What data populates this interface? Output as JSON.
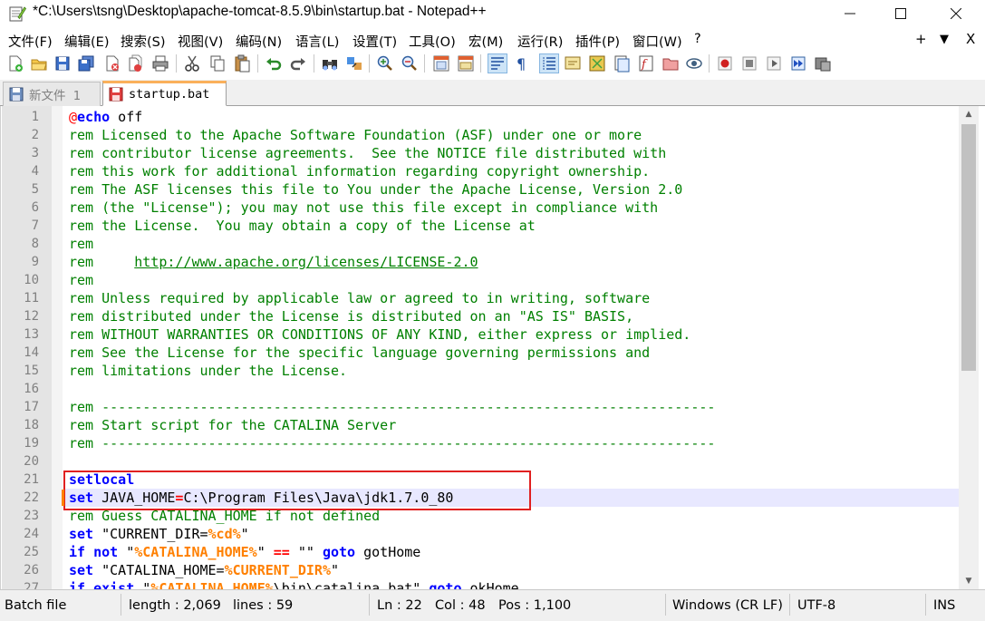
{
  "window": {
    "title": "*C:\\Users\\tsng\\Desktop\\apache-tomcat-8.5.9\\bin\\startup.bat - Notepad++",
    "minimize": "—",
    "maximize": "☐",
    "close": "✕"
  },
  "menu": {
    "items": [
      "文件(F)",
      "编辑(E)",
      "搜索(S)",
      "视图(V)",
      "编码(N)",
      "语言(L)",
      "设置(T)",
      "工具(O)",
      "宏(M)",
      "运行(R)",
      "插件(P)",
      "窗口(W)",
      "?"
    ],
    "plus": "+",
    "dropdown": "▼",
    "close": "X"
  },
  "tabs": [
    {
      "label": "新文件 1",
      "active": false
    },
    {
      "label": "startup.bat",
      "active": true
    }
  ],
  "editor": {
    "current_line": 22,
    "lines": [
      {
        "n": "1",
        "tokens": [
          {
            "t": "@",
            "c": "at"
          },
          {
            "t": "echo",
            "c": "kw"
          },
          {
            "t": " off",
            "c": "txt"
          }
        ]
      },
      {
        "n": "2",
        "tokens": [
          {
            "t": "rem Licensed to the Apache Software Foundation (ASF) under one or more",
            "c": "rem"
          }
        ]
      },
      {
        "n": "3",
        "tokens": [
          {
            "t": "rem contributor license agreements.  See the NOTICE file distributed with",
            "c": "rem"
          }
        ]
      },
      {
        "n": "4",
        "tokens": [
          {
            "t": "rem this work for additional information regarding copyright ownership.",
            "c": "rem"
          }
        ]
      },
      {
        "n": "5",
        "tokens": [
          {
            "t": "rem The ASF licenses this file to You under the Apache License, Version 2.0",
            "c": "rem"
          }
        ]
      },
      {
        "n": "6",
        "tokens": [
          {
            "t": "rem (the \"License\"); you may not use this file except in compliance with",
            "c": "rem"
          }
        ]
      },
      {
        "n": "7",
        "tokens": [
          {
            "t": "rem the License.  You may obtain a copy of the License at",
            "c": "rem"
          }
        ]
      },
      {
        "n": "8",
        "tokens": [
          {
            "t": "rem",
            "c": "rem"
          }
        ]
      },
      {
        "n": "9",
        "tokens": [
          {
            "t": "rem     ",
            "c": "rem"
          },
          {
            "t": "http://www.apache.org/licenses/LICENSE-2.0",
            "c": "link"
          }
        ]
      },
      {
        "n": "10",
        "tokens": [
          {
            "t": "rem",
            "c": "rem"
          }
        ]
      },
      {
        "n": "11",
        "tokens": [
          {
            "t": "rem Unless required by applicable law or agreed to in writing, software",
            "c": "rem"
          }
        ]
      },
      {
        "n": "12",
        "tokens": [
          {
            "t": "rem distributed under the License is distributed on an \"AS IS\" BASIS,",
            "c": "rem"
          }
        ]
      },
      {
        "n": "13",
        "tokens": [
          {
            "t": "rem WITHOUT WARRANTIES OR CONDITIONS OF ANY KIND, either express or implied.",
            "c": "rem"
          }
        ]
      },
      {
        "n": "14",
        "tokens": [
          {
            "t": "rem See the License for the specific language governing permissions and",
            "c": "rem"
          }
        ]
      },
      {
        "n": "15",
        "tokens": [
          {
            "t": "rem limitations under the License.",
            "c": "rem"
          }
        ]
      },
      {
        "n": "16",
        "tokens": []
      },
      {
        "n": "17",
        "tokens": [
          {
            "t": "rem ---------------------------------------------------------------------------",
            "c": "rem"
          }
        ]
      },
      {
        "n": "18",
        "tokens": [
          {
            "t": "rem Start script for the CATALINA Server",
            "c": "rem"
          }
        ]
      },
      {
        "n": "19",
        "tokens": [
          {
            "t": "rem ---------------------------------------------------------------------------",
            "c": "rem"
          }
        ]
      },
      {
        "n": "20",
        "tokens": []
      },
      {
        "n": "21",
        "tokens": [
          {
            "t": "setlocal",
            "c": "kw"
          }
        ]
      },
      {
        "n": "22",
        "tokens": [
          {
            "t": "set",
            "c": "kw"
          },
          {
            "t": " JAVA_HOME",
            "c": "txt"
          },
          {
            "t": "=",
            "c": "op"
          },
          {
            "t": "C:\\Program Files\\Java\\jdk1.7.0_80",
            "c": "txt"
          }
        ]
      },
      {
        "n": "23",
        "tokens": [
          {
            "t": "rem Guess CATALINA_HOME if not defined",
            "c": "rem"
          }
        ]
      },
      {
        "n": "24",
        "tokens": [
          {
            "t": "set",
            "c": "kw"
          },
          {
            "t": " \"CURRENT_DIR=",
            "c": "txt"
          },
          {
            "t": "%cd%",
            "c": "var"
          },
          {
            "t": "\"",
            "c": "txt"
          }
        ]
      },
      {
        "n": "25",
        "tokens": [
          {
            "t": "if not",
            "c": "kw"
          },
          {
            "t": " \"",
            "c": "txt"
          },
          {
            "t": "%CATALINA_HOME%",
            "c": "var"
          },
          {
            "t": "\" ",
            "c": "txt"
          },
          {
            "t": "==",
            "c": "op"
          },
          {
            "t": " \"\" ",
            "c": "txt"
          },
          {
            "t": "goto",
            "c": "kw"
          },
          {
            "t": " gotHome",
            "c": "txt"
          }
        ]
      },
      {
        "n": "26",
        "tokens": [
          {
            "t": "set",
            "c": "kw"
          },
          {
            "t": " \"CATALINA_HOME=",
            "c": "txt"
          },
          {
            "t": "%CURRENT_DIR%",
            "c": "var"
          },
          {
            "t": "\"",
            "c": "txt"
          }
        ]
      },
      {
        "n": "27",
        "tokens": [
          {
            "t": "if exist",
            "c": "kw"
          },
          {
            "t": " \"",
            "c": "txt"
          },
          {
            "t": "%CATALINA_HOME%",
            "c": "var"
          },
          {
            "t": "\\bin\\catalina.bat\" ",
            "c": "txt"
          },
          {
            "t": "goto",
            "c": "kw"
          },
          {
            "t": " okHome",
            "c": "txt"
          }
        ]
      }
    ]
  },
  "status": {
    "file_type": "Batch file",
    "length": "length : 2,069",
    "lines": "lines : 59",
    "ln": "Ln : 22",
    "col": "Col : 48",
    "pos": "Pos : 1,100",
    "eol": "Windows (CR LF)",
    "encoding": "UTF-8",
    "mode": "INS"
  },
  "colors": {
    "comment": "#008000",
    "keyword": "#0000ff",
    "variable": "#ff8000",
    "operator": "#ff0000",
    "current_line": "#e8e8ff",
    "annotation_box": "#e02020",
    "active_tab_accent": "#fab05b"
  }
}
